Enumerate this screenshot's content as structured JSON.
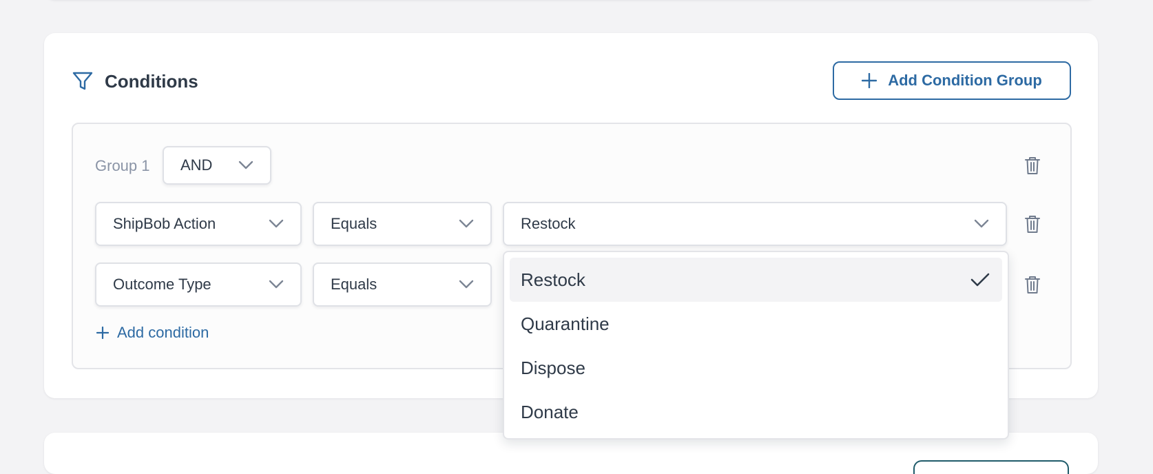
{
  "conditions": {
    "title": "Conditions",
    "add_group_label": "Add Condition Group",
    "group": {
      "label": "Group 1",
      "operator": "AND",
      "rows": [
        {
          "field": "ShipBob Action",
          "operator": "Equals",
          "value": "Restock"
        },
        {
          "field": "Outcome Type",
          "operator": "Equals",
          "value": ""
        }
      ],
      "add_condition_label": "Add condition"
    },
    "dropdown": {
      "options": [
        "Restock",
        "Quarantine",
        "Dispose",
        "Donate"
      ],
      "selected": "Restock"
    }
  },
  "icons": {
    "header": "filter-icon",
    "add": "plus-icon",
    "expand": "chevron-down-icon",
    "delete": "trash-icon",
    "selected": "checkmark-icon"
  },
  "colors": {
    "accent": "#2d6aa3",
    "text": "#2f3a48",
    "muted": "#8a94a6",
    "page_bg": "#f3f3f5",
    "selected_bg": "#f3f3f5"
  }
}
